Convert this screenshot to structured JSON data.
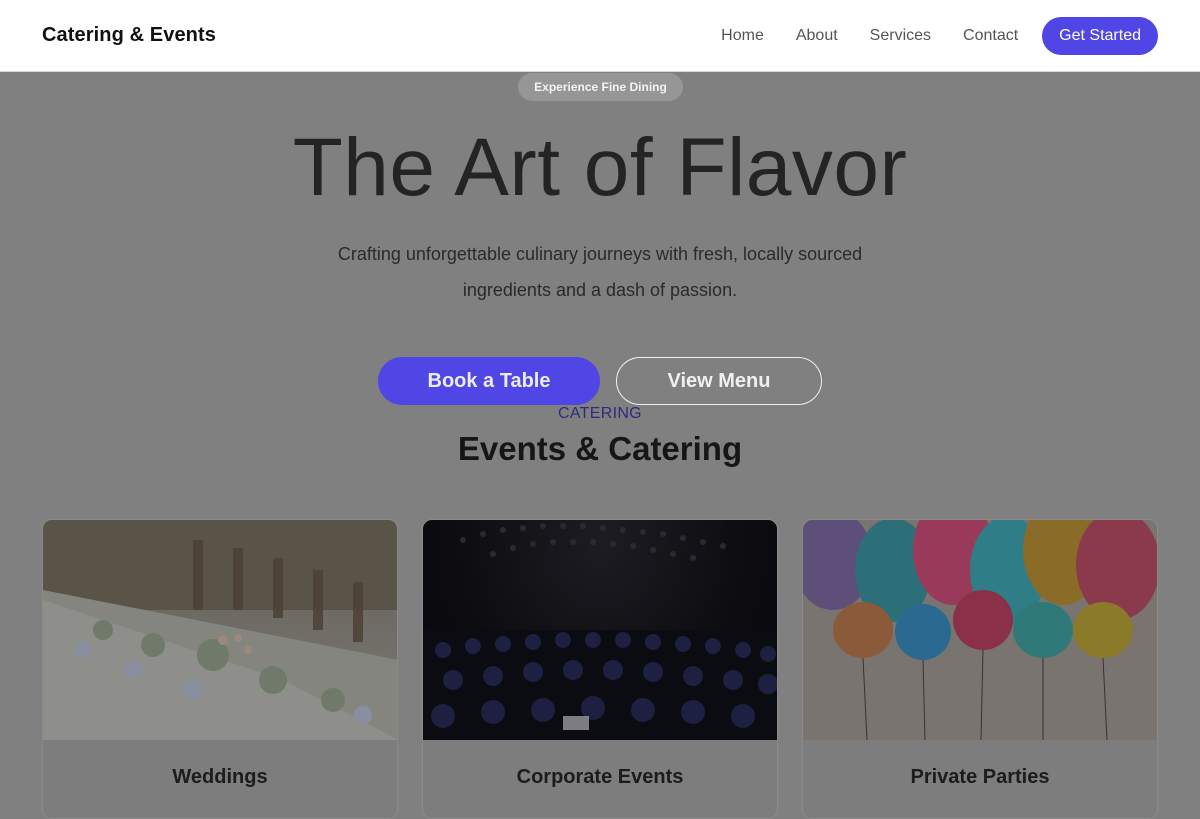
{
  "nav": {
    "brand": "Catering & Events",
    "links": [
      "Home",
      "About",
      "Services",
      "Contact"
    ],
    "cta": "Get Started"
  },
  "hero": {
    "pill": "Experience Fine Dining",
    "title": "The Art of Flavor",
    "subtitle": "Crafting unforgettable culinary journeys with fresh, locally sourced ingredients and a dash of passion.",
    "primary_button": "Book a Table",
    "secondary_button": "View Menu"
  },
  "section": {
    "eyebrow": "CATERING",
    "title": "Events & Catering"
  },
  "cards": [
    {
      "title": "Weddings",
      "image": "wedding-table-photo"
    },
    {
      "title": "Corporate Events",
      "image": "conference-audience-photo"
    },
    {
      "title": "Private Parties",
      "image": "colorful-balloons-photo"
    }
  ],
  "colors": {
    "accent": "#4f46e5",
    "overlay": "#808080",
    "eyebrow": "#2e2a80"
  }
}
